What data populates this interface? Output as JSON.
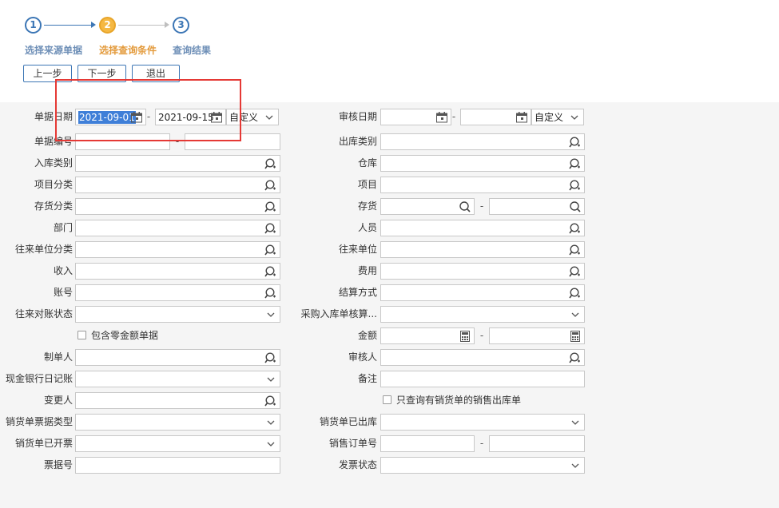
{
  "wizard": {
    "steps": [
      {
        "num": "1",
        "label": "选择来源单据"
      },
      {
        "num": "2",
        "label": "选择查询条件"
      },
      {
        "num": "3",
        "label": "查询结果"
      }
    ],
    "buttons": {
      "prev": "上一步",
      "next": "下一步",
      "exit": "退出"
    }
  },
  "form": {
    "doc_date": {
      "label": "单据日期",
      "from": "2021-09-01",
      "to": "2021-09-15",
      "mode": "自定义"
    },
    "audit_date": {
      "label": "审核日期",
      "from": "",
      "to": "",
      "mode": "自定义"
    },
    "doc_no": {
      "label": "单据编号"
    },
    "outbound_type": {
      "label": "出库类别"
    },
    "inbound_type": {
      "label": "入库类别"
    },
    "warehouse": {
      "label": "仓库"
    },
    "project_category": {
      "label": "项目分类"
    },
    "project": {
      "label": "项目"
    },
    "inventory_category": {
      "label": "存货分类"
    },
    "inventory": {
      "label": "存货"
    },
    "department": {
      "label": "部门"
    },
    "staff": {
      "label": "人员"
    },
    "partner_category": {
      "label": "往来单位分类"
    },
    "partner": {
      "label": "往来单位"
    },
    "income": {
      "label": "收入"
    },
    "expense": {
      "label": "费用"
    },
    "account": {
      "label": "账号"
    },
    "settlement": {
      "label": "结算方式"
    },
    "reconcile_status": {
      "label": "往来对账状态"
    },
    "purchase_check": {
      "label": "采购入库单核算..."
    },
    "include_zero": {
      "label": "包含零金额单据"
    },
    "amount": {
      "label": "金额"
    },
    "creator": {
      "label": "制单人"
    },
    "auditor": {
      "label": "审核人"
    },
    "cash_bank_journal": {
      "label": "现金银行日记账"
    },
    "remark": {
      "label": "备注"
    },
    "modifier": {
      "label": "变更人"
    },
    "only_sales_outbound": {
      "label": "只查询有销货单的销售出库单"
    },
    "sales_doc_type": {
      "label": "销货单票据类型"
    },
    "sales_outbound_done": {
      "label": "销货单已出库"
    },
    "sales_invoiced": {
      "label": "销货单已开票"
    },
    "sales_order_no": {
      "label": "销售订单号"
    },
    "bill_no": {
      "label": "票据号"
    },
    "invoice_status": {
      "label": "发票状态"
    }
  },
  "separator": "-",
  "colors": {
    "accent": "#3c76b5",
    "active_step": "#f5b843",
    "highlight": "#e53935"
  }
}
